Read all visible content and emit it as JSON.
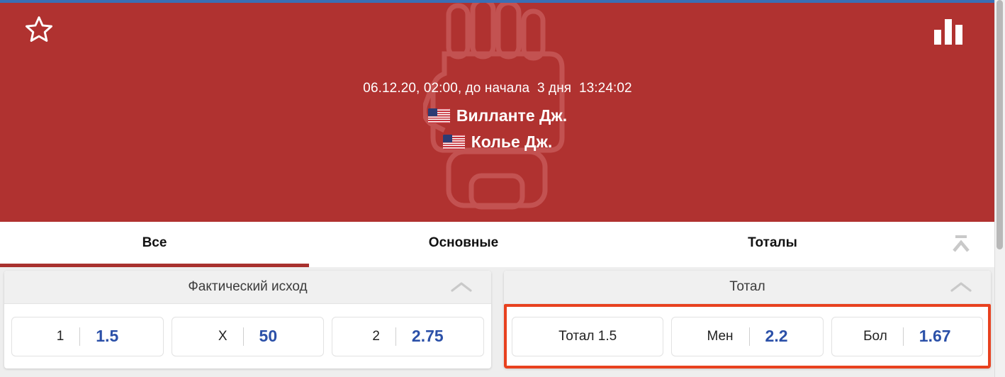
{
  "header": {
    "favorite_icon": "star-outline-icon",
    "stats_icon": "bar-chart-icon",
    "watermark_icon": "mma-glove-icon",
    "background_color": "#b03230",
    "event_time": "06.12.20, 02:00, до начала  3 дня  13:24:02",
    "teams": [
      {
        "flag": "us-flag-icon",
        "name": "Вилланте Дж."
      },
      {
        "flag": "us-flag-icon",
        "name": "Колье Дж."
      }
    ]
  },
  "tabs": {
    "items": [
      {
        "label": "Все",
        "active": true
      },
      {
        "label": "Основные",
        "active": false
      },
      {
        "label": "Тоталы",
        "active": false
      }
    ],
    "collapse_all_icon": "collapse-all-icon",
    "active_underline_color": "#a8312e"
  },
  "markets": [
    {
      "title": "Фактический исход",
      "collapse_icon": "chevron-up-icon",
      "highlighted": false,
      "outcomes": [
        {
          "name": "1",
          "value": "1.5"
        },
        {
          "name": "X",
          "value": "50"
        },
        {
          "name": "2",
          "value": "2.75"
        }
      ]
    },
    {
      "title": "Тотал",
      "collapse_icon": "chevron-up-icon",
      "highlighted": true,
      "highlight_color": "#e8411f",
      "outcomes": [
        {
          "name": "Тотал 1.5",
          "value": ""
        },
        {
          "name": "Мен",
          "value": "2.2"
        },
        {
          "name": "Бол",
          "value": "1.67"
        }
      ]
    }
  ],
  "colors": {
    "odds_value": "#2b50a8",
    "header_red": "#b03230",
    "highlight_red": "#e8411f",
    "top_strip_blue": "#3a6fb5"
  }
}
